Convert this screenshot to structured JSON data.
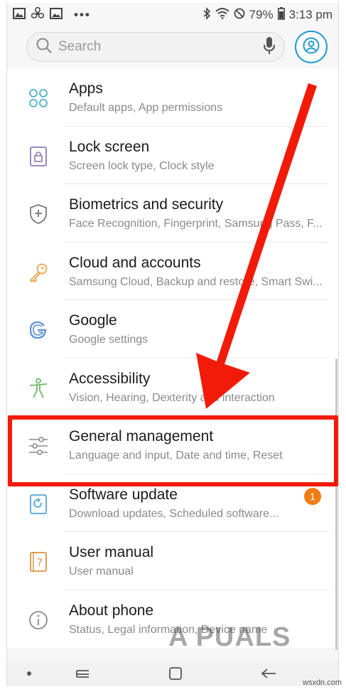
{
  "status_bar": {
    "battery": "79%",
    "time": "3:13 pm"
  },
  "search": {
    "placeholder": "Search"
  },
  "items": [
    {
      "title": "Apps",
      "subtitle": "Default apps, App permissions",
      "icon": "apps-grid-icon"
    },
    {
      "title": "Lock screen",
      "subtitle": "Screen lock type, Clock style",
      "icon": "lock-icon"
    },
    {
      "title": "Biometrics and security",
      "subtitle": "Face Recognition, Fingerprint, Samsung Pass, F...",
      "icon": "shield-plus-icon"
    },
    {
      "title": "Cloud and accounts",
      "subtitle": "Samsung Cloud, Backup and restore, Smart Swi...",
      "icon": "key-icon"
    },
    {
      "title": "Google",
      "subtitle": "Google settings",
      "icon": "google-icon"
    },
    {
      "title": "Accessibility",
      "subtitle": "Vision, Hearing, Dexterity and interaction",
      "icon": "accessibility-icon"
    },
    {
      "title": "General management",
      "subtitle": "Language and input, Date and time, Reset",
      "icon": "sliders-icon"
    },
    {
      "title": "Software update",
      "subtitle": "Download updates, Scheduled software...",
      "icon": "software-update-icon",
      "badge": "1"
    },
    {
      "title": "User manual",
      "subtitle": "User manual",
      "icon": "question-book-icon"
    },
    {
      "title": "About phone",
      "subtitle": "Status, Legal information, Device name",
      "icon": "info-icon"
    }
  ],
  "colors": {
    "highlight": "#f21b0a",
    "accent": "#1d9bd0",
    "badge": "#f07d12"
  },
  "watermark": "A PUALS",
  "source_tag": "wsxdn.com"
}
